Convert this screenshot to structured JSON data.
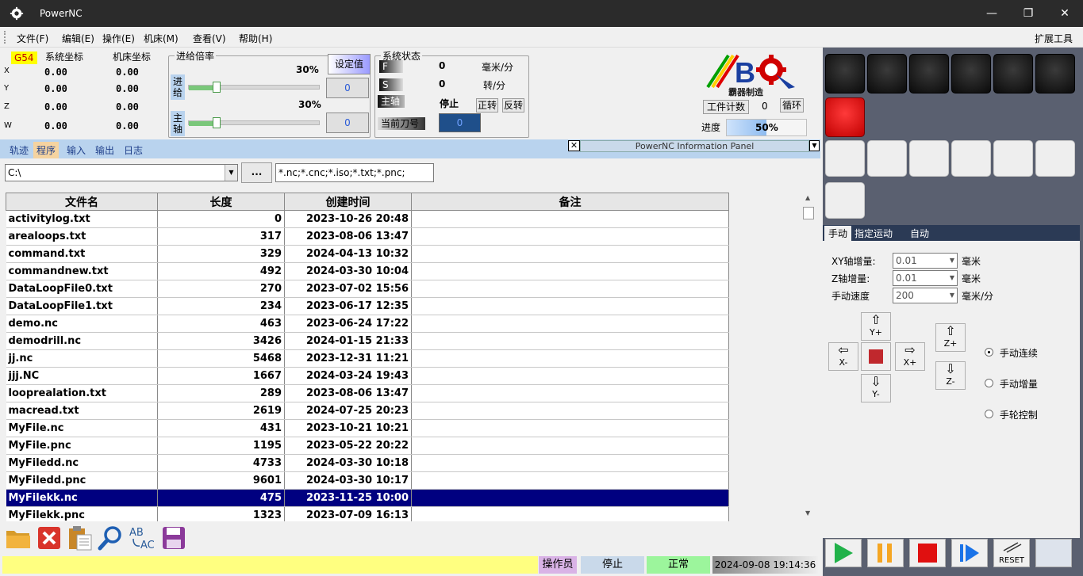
{
  "app": {
    "title": "PowerNC"
  },
  "window_controls": {
    "minimize": "—",
    "restore": "❐",
    "close": "✕"
  },
  "menu": {
    "items": [
      "文件(F)",
      "编辑(E)",
      "操作(E)",
      "机床(M)",
      "查看(V)",
      "帮助(H)"
    ],
    "extension": "扩展工具"
  },
  "coords": {
    "wcs": "G54",
    "sys_label": "系统坐标",
    "mach_label": "机床坐标",
    "axes": [
      {
        "name": "X",
        "sys": "0.00",
        "mach": "0.00"
      },
      {
        "name": "Y",
        "sys": "0.00",
        "mach": "0.00"
      },
      {
        "name": "Z",
        "sys": "0.00",
        "mach": "0.00"
      },
      {
        "name": "W",
        "sys": "0.00",
        "mach": "0.00"
      }
    ]
  },
  "feed_override": {
    "title": "进给倍率",
    "set_label": "设定值",
    "feed_label": "进给",
    "feed_pct": "30%",
    "feed_value": "0",
    "feed_level": 0.3,
    "spindle_label": "主轴",
    "spindle_pct": "30%",
    "spindle_value": "0",
    "spindle_level": 0.3
  },
  "system_status": {
    "title": "系统状态",
    "f_label": "F",
    "f_value": "0",
    "f_unit": "毫米/分",
    "s_label": "S",
    "s_value": "0",
    "s_unit": "转/分",
    "spindle_label": "主轴",
    "spindle_state": "停止",
    "cw": "正转",
    "ccw": "反转",
    "tool_label": "当前刀号",
    "tool_value": "0"
  },
  "brand": {
    "text": "霸器制造"
  },
  "counter": {
    "label": "工件计数",
    "value": "0",
    "cycle": "循环"
  },
  "progress": {
    "label": "进度",
    "value": "50%",
    "level": 0.5
  },
  "tabs": [
    "轨迹",
    "程序",
    "输入",
    "输出",
    "日志"
  ],
  "active_tab": 1,
  "info_panel": {
    "title": "PowerNC Information Panel"
  },
  "file_browser": {
    "path": "C:\\",
    "browse": "...",
    "filter": "*.nc;*.cnc;*.iso;*.txt;*.pnc;",
    "columns": [
      "文件名",
      "长度",
      "创建时间",
      "备注"
    ],
    "rows": [
      [
        "activitylog.txt",
        "0",
        "2023-10-26 20:48",
        ""
      ],
      [
        "arealoops.txt",
        "317",
        "2023-08-06 13:47",
        ""
      ],
      [
        "command.txt",
        "329",
        "2024-04-13 10:32",
        ""
      ],
      [
        "commandnew.txt",
        "492",
        "2024-03-30 10:04",
        ""
      ],
      [
        "DataLoopFile0.txt",
        "270",
        "2023-07-02 15:56",
        ""
      ],
      [
        "DataLoopFile1.txt",
        "234",
        "2023-06-17 12:35",
        ""
      ],
      [
        "demo.nc",
        "463",
        "2023-06-24 17:22",
        ""
      ],
      [
        "demodrill.nc",
        "3426",
        "2024-01-15 21:33",
        ""
      ],
      [
        "jj.nc",
        "5468",
        "2023-12-31 11:21",
        ""
      ],
      [
        "jjj.NC",
        "1667",
        "2024-03-24 19:43",
        ""
      ],
      [
        "looprealation.txt",
        "289",
        "2023-08-06 13:47",
        ""
      ],
      [
        "macread.txt",
        "2619",
        "2024-07-25 20:23",
        ""
      ],
      [
        "MyFile.nc",
        "431",
        "2023-10-21 10:21",
        ""
      ],
      [
        "MyFile.pnc",
        "1195",
        "2023-05-22 20:22",
        ""
      ],
      [
        "MyFiledd.nc",
        "4733",
        "2024-03-30 10:18",
        ""
      ],
      [
        "MyFiledd.pnc",
        "9601",
        "2024-03-30 10:17",
        ""
      ],
      [
        "MyFilekk.nc",
        "475",
        "2023-11-25 10:00",
        ""
      ],
      [
        "MyFilekk.pnc",
        "1323",
        "2023-07-09 16:13",
        ""
      ]
    ],
    "selected_index": 16,
    "toolbar_icons": [
      "open-folder-icon",
      "delete-icon",
      "paste-icon",
      "search-icon",
      "replace-icon",
      "save-icon"
    ],
    "replace_icon_text": [
      "AB",
      "AC"
    ]
  },
  "statusbar": {
    "operator": "操作员",
    "state": "停止",
    "normal": "正常",
    "datetime": "2024-09-08 19:14:36"
  },
  "jog": {
    "tabs": [
      "手动",
      "指定运动",
      "自动"
    ],
    "xy_inc_label": "XY轴增量:",
    "xy_inc_value": "0.01",
    "xy_unit": "毫米",
    "z_inc_label": "Z轴增量:",
    "z_inc_value": "0.01",
    "z_unit": "毫米",
    "speed_label": "手动速度",
    "speed_value": "200",
    "speed_unit": "毫米/分",
    "y_plus": "Y+",
    "y_minus": "Y-",
    "x_plus": "X+",
    "x_minus": "X-",
    "z_plus": "Z+",
    "z_minus": "Z-",
    "modes": [
      "手动连续",
      "手动增量",
      "手轮控制"
    ],
    "selected_mode": 0
  },
  "control_buttons": {
    "reset": "RESET"
  },
  "colors": {
    "accent": "#000080",
    "tab_bar": "#b9d3ee",
    "status_yellow": "#ffff80",
    "start_green": "#21b24a",
    "pause_orange": "#f5a623",
    "stop_red": "#e01010",
    "step_blue": "#1a73e8"
  }
}
